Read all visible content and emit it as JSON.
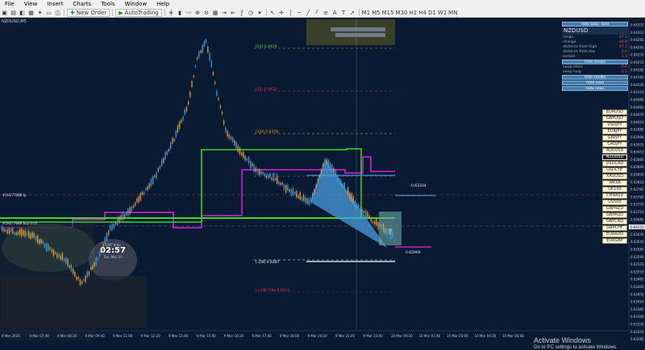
{
  "menu": [
    "File",
    "View",
    "Insert",
    "Charts",
    "Tools",
    "Window",
    "Help"
  ],
  "toolbar": {
    "new_order": "New Order",
    "autotrading": "AutoTrading"
  },
  "chart": {
    "symbol_title": "NZDUSD,M5",
    "y_ticks": [
      "0.64335",
      "0.64310",
      "0.64285",
      "0.64260",
      "0.64235",
      "0.64210",
      "0.64185",
      "0.64160",
      "0.64135",
      "0.64110",
      "0.64085",
      "0.64060",
      "0.64035",
      "0.64010",
      "0.63985",
      "0.63960",
      "0.63935",
      "0.63910",
      "0.63885",
      "0.63860",
      "0.63835",
      "0.63810",
      "0.63785",
      "0.63760",
      "0.63735",
      "0.63710",
      "0.63685",
      "0.63660",
      "0.63635",
      "0.63610",
      "0.63585",
      "0.63560",
      "0.63535",
      "0.63510",
      "0.63485",
      "0.63460",
      "0.63435",
      "0.63410",
      "0.63385",
      "0.63360",
      "0.63335",
      "0.63310",
      "0.63285"
    ],
    "x_ticks": [
      "9 Mar 2020",
      "9 Mar 07:40",
      "9 Mar 08:20",
      "9 Mar 09:40",
      "9 Mar 11:00",
      "9 Mar 12:20",
      "9 Mar 13:40",
      "9 Mar 15:00",
      "9 Mar 16:20",
      "9 Mar 17:40",
      "9 Mar 19:00",
      "9 Mar 20:20",
      "9 Mar 21:40",
      "9 Mar 23:00",
      "10 Mar 00:20",
      "10 Mar 01:40",
      "10 Mar 03:00",
      "10 Mar 04:20",
      "10 Mar 05:40"
    ],
    "fib_levels": [
      {
        "label": "[50] 0.6438",
        "color": "#52c83c"
      },
      {
        "label": "[25] 0.6433",
        "color": "#e04040"
      },
      {
        "label": "[1/8] 0.6378",
        "color": "#f0a020"
      },
      {
        "label": "[0/8] 0.6330",
        "color": "#4a7fe0"
      },
      {
        "label": "[-2/8] 0.6287",
        "color": "#ffffff"
      },
      {
        "label": "[+1/8] Fibo 0.6254",
        "color": "#e04040"
      }
    ],
    "right_labels": {
      "upper": "0.63334",
      "lower": "0.62969"
    },
    "left_labels": {
      "magenta": "#1H27768B tp",
      "green": "#1H27768B buy 0.05"
    },
    "price_marker": "0.64115"
  },
  "clock": {
    "label": "GMT time",
    "time": "02:57",
    "date": "Tue, Mar 10"
  },
  "info_panel": {
    "hide_basic": "Hide basic data",
    "symbol": "NZDUSD",
    "rows": [
      {
        "k": "range",
        "v": "47.3"
      },
      {
        "k": "change",
        "v": "-20.8"
      },
      {
        "k": "distance from high",
        "v": "47.3"
      },
      {
        "k": "distance from low",
        "v": "0.0"
      },
      {
        "k": "spread",
        "v": "1.3"
      }
    ],
    "hide_swaps": "Hide swaps",
    "swap_rows": [
      {
        "k": "swap short",
        "v": "-0.6"
      },
      {
        "k": "swap long",
        "v": "-3.2"
      }
    ],
    "hide_candle": "Hide candle",
    "hide_area": "Hide area",
    "hide_news": "Hide news"
  },
  "symbols": [
    "EURUSD",
    "GBPUSD",
    "USDJPY",
    "EURJPY",
    "GBPJPY",
    "CADJPY",
    "AUDUSD",
    "NZDUSD",
    "USDCAD",
    "USDCHF",
    "XAUUSD",
    "WKS8",
    "UK100",
    "CHNA50",
    "US500",
    "GBPNZD",
    "GBPAUD",
    "GBPCAD",
    "GBPCHF",
    "EURAUD",
    "EURGBP"
  ],
  "active_symbol": "NZDUSD",
  "watermark": {
    "line1": "Activate Windows",
    "line2": "Go to PC settings to activate Windows."
  },
  "colors": {
    "bg": "#0b1a33",
    "bull": "#3aa0e0",
    "bear": "#e0a040",
    "green": "#33dd22",
    "magenta": "#e020e0"
  }
}
